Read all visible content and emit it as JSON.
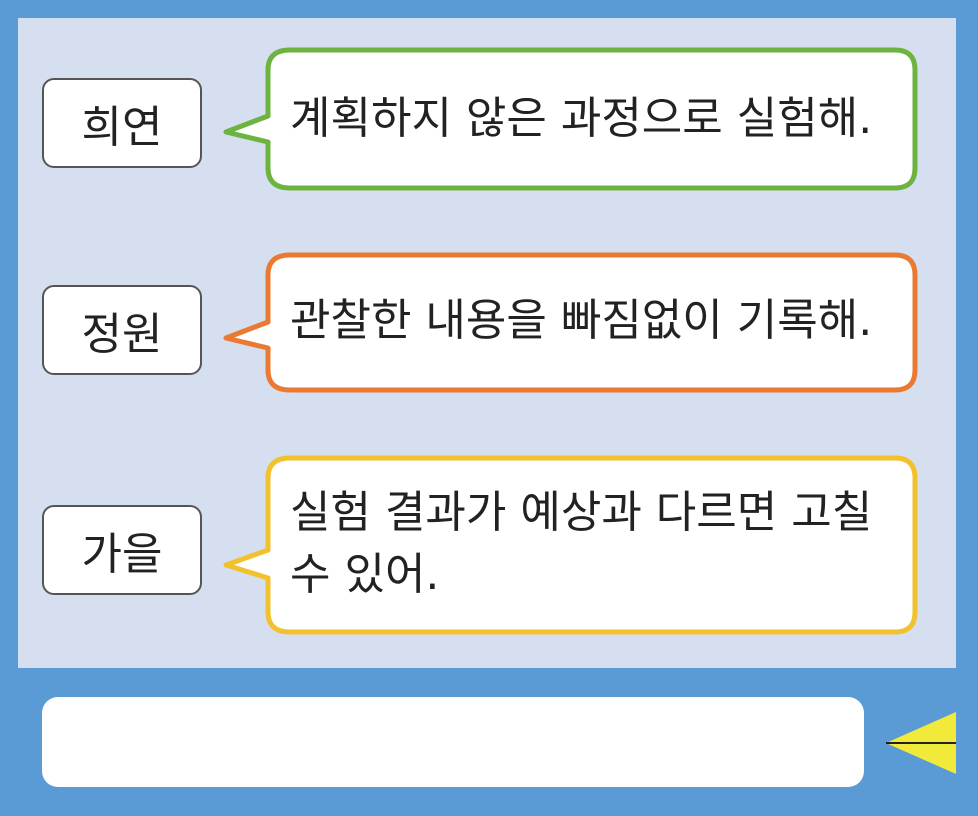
{
  "messages": [
    {
      "speaker": "희연",
      "text": "계획하지 않은 과정으로 실험해.",
      "color": "#6cb33f"
    },
    {
      "speaker": "정원",
      "text": "관찰한 내용을 빠짐없이 기록해.",
      "color": "#ea7a32"
    },
    {
      "speaker": "가을",
      "text": "실험 결과가 예상과 다르면 고칠 수 있어.",
      "color": "#f2c12e"
    }
  ],
  "input": {
    "value": ""
  },
  "send": {
    "icon": "send-arrow-icon",
    "color": "#f2ea3a"
  },
  "colors": {
    "frame": "#5b9bd5",
    "chat_background": "#d5dff0"
  }
}
